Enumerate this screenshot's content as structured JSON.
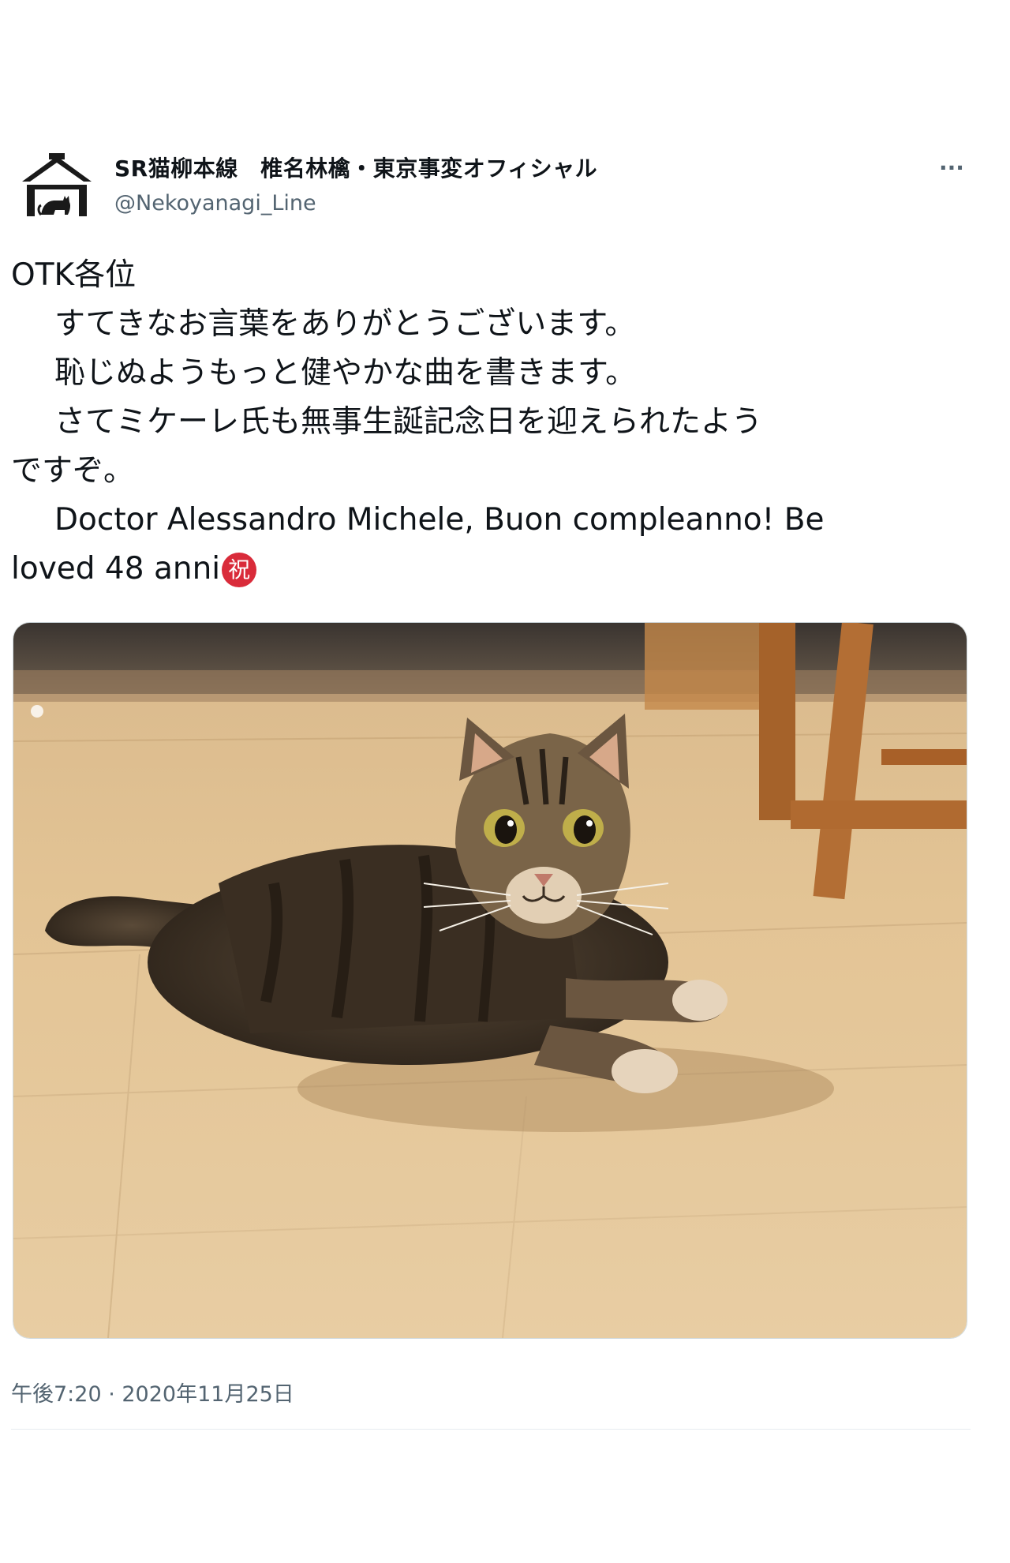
{
  "tweet": {
    "display_name": "SR猫柳本線　椎名林檎・東京事変オフィシャル",
    "handle": "@Nekoyanagi_Line",
    "more_label": "···",
    "text_lines": [
      "OTK各位",
      "すてきなお言葉をありがとうございます。",
      "恥じぬようもっと健やかな曲を書きます。",
      "さてミケーレ氏も無事生誕記念日を迎えられたよう",
      "ですぞ。",
      "Doctor Alessandro Michele, Buon compleanno! Be",
      "loved 48 anni"
    ],
    "emoji": "祝",
    "timestamp": "午後7:20 · 2020年11月25日",
    "colors": {
      "text": "#0f1419",
      "secondary": "#536471",
      "emoji_bg": "#d92b3a",
      "divider": "#e6ecf0"
    },
    "icons": {
      "avatar": "house-with-cat-logo",
      "more": "more-horizontal-icon",
      "emoji": "congratulations-emoji"
    }
  }
}
